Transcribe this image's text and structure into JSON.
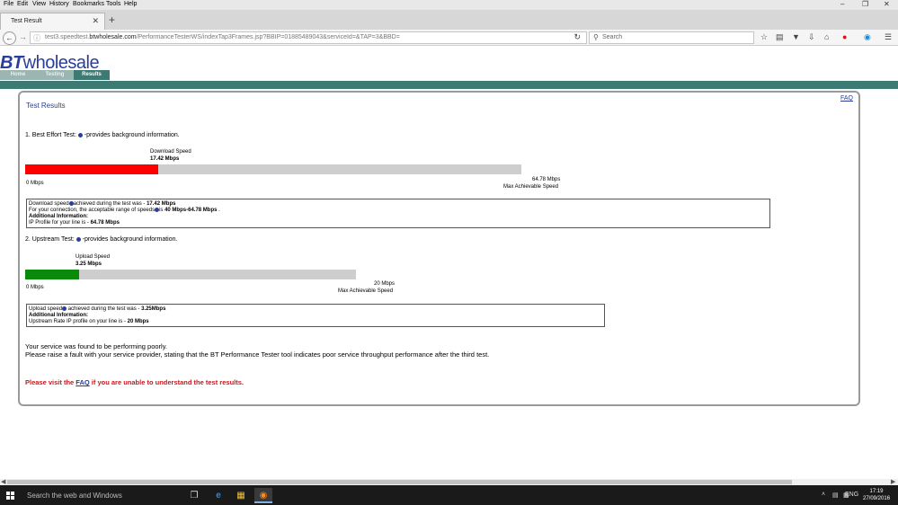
{
  "browser": {
    "menu": [
      "File",
      "Edit",
      "View",
      "History",
      "Bookmarks",
      "Tools",
      "Help"
    ],
    "tab_title": "Test Result",
    "url_prefix": "test3.speedtest.",
    "url_host": "btwholesale.com",
    "url_path": "/PerformanceTesterWS/indexTap3Frames.jsp?BBIP=01885489043&serviceId=&TAP=3&BBD=",
    "search_placeholder": "Search"
  },
  "site": {
    "logo_bt": "BT",
    "logo_wholesale": "wholesale",
    "tabs": [
      "Home",
      "Testing",
      "Results"
    ],
    "colors": {
      "brand_blue": "#2a3d9a",
      "band_teal": "#3d7a74",
      "download_red": "#ff0000",
      "upload_green": "#0a8a0a",
      "notice_red": "#c8171e"
    }
  },
  "page": {
    "faq": "FAQ",
    "title": "Test Results",
    "download": {
      "heading_a": "1. Best Effort Test: ",
      "heading_b": " -provides background information.",
      "bar_label": "Download Speed",
      "bar_value": "17.42 Mbps",
      "value_mbps": 17.42,
      "max_mbps": 64.78,
      "min_label": "0 Mbps",
      "max_label": "64.78 Mbps",
      "max_caption": "Max Achievable Speed",
      "info": {
        "l1a": "Download speed",
        "l1b": "achieved during the test was - ",
        "l1c": "17.42 Mbps",
        "l2a": "For your connection, the acceptable range of speeds",
        "l2b": "is ",
        "l2c": "40 Mbps",
        "l2d": "-",
        "l2e": "64.78 Mbps",
        "l2f": " .",
        "l3": "Additional Information:",
        "l4a": "IP Profile for your line is - ",
        "l4b": "64.78 Mbps"
      }
    },
    "upload": {
      "heading_a": "2. Upstream Test: ",
      "heading_b": " -provides background information.",
      "bar_label": "Upload Speed",
      "bar_value": "3.25 Mbps",
      "value_mbps": 3.25,
      "max_mbps": 20,
      "min_label": "0 Mbps",
      "max_label": "20 Mbps",
      "max_caption": "Max Achievable Speed",
      "info": {
        "l1a": "Upload speed",
        "l1b": " achieved during the test was - ",
        "l1c": "3.25Mbps",
        "l2": "Additional Information:",
        "l3a": "Upstream Rate IP profile on your line is - ",
        "l3b": "20 Mbps"
      }
    },
    "summary_1": "Your service was found to be performing poorly.",
    "summary_2": "Please raise a fault with your service provider, stating that the BT Performance Tester tool indicates poor service throughput performance after the third test.",
    "notice_a": "Please visit the ",
    "notice_link": "FAQ",
    "notice_b": " if you are unable to understand the test results."
  },
  "taskbar": {
    "search_text": "Search the web and Windows",
    "language": "ENG",
    "time": "17:19",
    "date": "27/09/2016"
  }
}
